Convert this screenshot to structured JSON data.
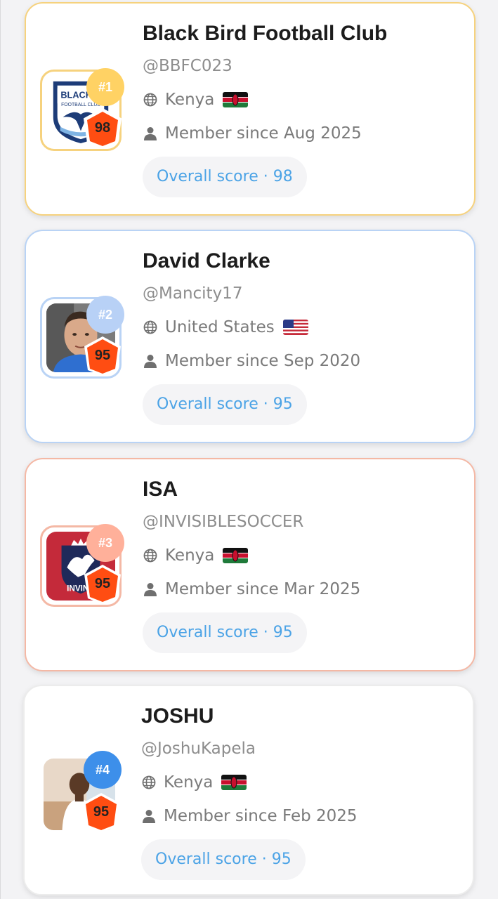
{
  "leaderboard": [
    {
      "rank_label": "#1",
      "score": "98",
      "name": "Black Bird Football Club",
      "handle": "@BBFC023",
      "country": "Kenya",
      "country_flag": "kenya-flag",
      "member_since": "Member since Aug 2025",
      "overall": "Overall score · 98",
      "avatar_text": "BLACK B"
    },
    {
      "rank_label": "#2",
      "score": "95",
      "name": "David Clarke",
      "handle": "@Mancity17",
      "country": "United States",
      "country_flag": "usa-flag",
      "member_since": "Member since Sep 2020",
      "overall": "Overall score · 95"
    },
    {
      "rank_label": "#3",
      "score": "95",
      "name": "ISA",
      "handle": "@INVISIBLESOCCER",
      "country": "Kenya",
      "country_flag": "kenya-flag",
      "member_since": "Member since Mar 2025",
      "overall": "Overall score · 95",
      "avatar_text": "INVINC"
    },
    {
      "rank_label": "#4",
      "score": "95",
      "name": "JOSHU",
      "handle": "@JoshuKapela",
      "country": "Kenya",
      "country_flag": "kenya-flag",
      "member_since": "Member since Feb 2025",
      "overall": "Overall score · 95"
    }
  ],
  "colors": {
    "gold": "#f6d27e",
    "silver_blue": "#b9d3f5",
    "bronze": "#f4b8a5",
    "rank4_badge": "#3d8fea",
    "score_text": "#4ba3e6",
    "shield": "#ff4d12"
  }
}
